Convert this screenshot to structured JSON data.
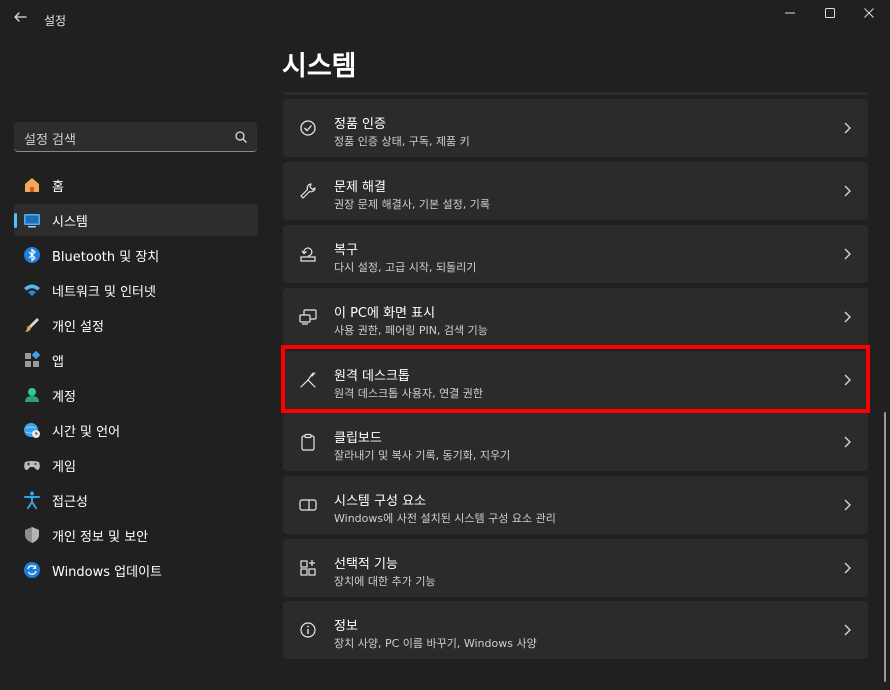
{
  "window": {
    "title": "설정",
    "controls": [
      "minimize",
      "maximize",
      "close"
    ]
  },
  "search": {
    "placeholder": "설정 검색",
    "icon": "search-icon"
  },
  "sidebar": {
    "items": [
      {
        "label": "홈",
        "icon": "home-icon",
        "selected": false
      },
      {
        "label": "시스템",
        "icon": "system-icon",
        "selected": true
      },
      {
        "label": "Bluetooth 및 장치",
        "icon": "bluetooth-icon",
        "selected": false
      },
      {
        "label": "네트워크 및 인터넷",
        "icon": "network-icon",
        "selected": false
      },
      {
        "label": "개인 설정",
        "icon": "brush-icon",
        "selected": false
      },
      {
        "label": "앱",
        "icon": "apps-icon",
        "selected": false
      },
      {
        "label": "계정",
        "icon": "account-icon",
        "selected": false
      },
      {
        "label": "시간 및 언어",
        "icon": "globe-clock-icon",
        "selected": false
      },
      {
        "label": "게임",
        "icon": "gamepad-icon",
        "selected": false
      },
      {
        "label": "접근성",
        "icon": "accessibility-icon",
        "selected": false
      },
      {
        "label": "개인 정보 및 보안",
        "icon": "shield-icon",
        "selected": false
      },
      {
        "label": "Windows 업데이트",
        "icon": "update-icon",
        "selected": false
      }
    ]
  },
  "main": {
    "title": "시스템",
    "cards": [
      {
        "title": "정품 인증",
        "subtitle": "정품 인증 상태, 구독, 제품 키",
        "icon": "check-circle-icon"
      },
      {
        "title": "문제 해결",
        "subtitle": "권장 문제 해결사, 기본 설정, 기록",
        "icon": "wrench-icon"
      },
      {
        "title": "복구",
        "subtitle": "다시 설정, 고급 시작, 되돌리기",
        "icon": "recovery-icon"
      },
      {
        "title": "이 PC에 화면 표시",
        "subtitle": "사용 권한, 페어링 PIN, 검색 기능",
        "icon": "project-icon"
      },
      {
        "title": "원격 데스크톱",
        "subtitle": "원격 데스크톱 사용자, 연결 권한",
        "icon": "remote-desktop-icon",
        "highlighted": true
      },
      {
        "title": "클립보드",
        "subtitle": "잘라내기 및 복사 기록, 동기화, 지우기",
        "icon": "clipboard-icon"
      },
      {
        "title": "시스템 구성 요소",
        "subtitle": "Windows에 사전 설치된 시스템 구성 요소 관리",
        "icon": "components-icon"
      },
      {
        "title": "선택적 기능",
        "subtitle": "장치에 대한 추가 기능",
        "icon": "optional-features-icon"
      },
      {
        "title": "정보",
        "subtitle": "장치 사양, PC 이름 바꾸기, Windows 사양",
        "icon": "info-icon"
      }
    ]
  },
  "colors": {
    "background": "#202020",
    "card": "#2b2b2b",
    "accent": "#4cc2ff",
    "highlight_border": "#ff0000"
  }
}
